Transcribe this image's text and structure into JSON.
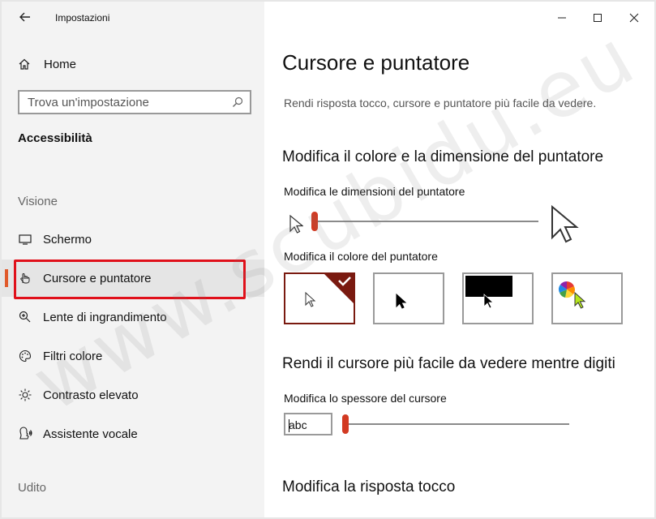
{
  "window": {
    "app_title": "Impostazioni",
    "controls": {
      "minimize": "—",
      "maximize": "☐",
      "close": "✕"
    }
  },
  "sidebar": {
    "home_label": "Home",
    "search_placeholder": "Trova un'impostazione",
    "section_title": "Accessibilità",
    "categories": {
      "vision": "Visione",
      "hearing": "Udito"
    },
    "items": [
      {
        "label": "Schermo",
        "icon": "monitor-icon"
      },
      {
        "label": "Cursore e puntatore",
        "icon": "pointer-hand-icon",
        "selected": true
      },
      {
        "label": "Lente di ingrandimento",
        "icon": "magnifier-icon"
      },
      {
        "label": "Filtri colore",
        "icon": "palette-icon"
      },
      {
        "label": "Contrasto elevato",
        "icon": "sun-icon"
      },
      {
        "label": "Assistente vocale",
        "icon": "narrator-icon"
      }
    ]
  },
  "main": {
    "title": "Cursore e puntatore",
    "description": "Rendi risposta tocco, cursore e puntatore più facile da vedere.",
    "pointer_section": {
      "heading": "Modifica il colore e la dimensione del puntatore",
      "size_label": "Modifica le dimensioni del puntatore",
      "size_value": 1,
      "color_label": "Modifica il colore del puntatore",
      "color_options": [
        "white",
        "black",
        "inverted",
        "custom"
      ],
      "selected_color": "white"
    },
    "cursor_section": {
      "heading": "Rendi il cursore più facile da vedere mentre digiti",
      "thickness_label": "Modifica lo spessore del cursore",
      "preview_text": "abc",
      "thickness_value": 1
    },
    "touch_section": {
      "heading": "Modifica la risposta tocco"
    }
  },
  "watermark": "www.scubidu.eu",
  "colors": {
    "accent": "#d23a22",
    "selection_bar": "#e05a2b",
    "highlight_box": "#e0101a"
  }
}
